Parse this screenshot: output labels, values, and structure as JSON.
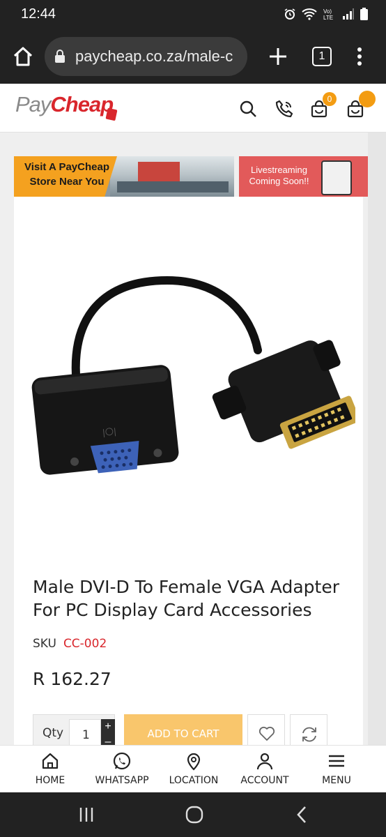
{
  "status_bar": {
    "time": "12:44",
    "icons": [
      "alarm-icon",
      "wifi-icon",
      "lte-icon",
      "signal-icon",
      "battery-icon"
    ]
  },
  "browser": {
    "url": "paycheap.co.za/male-c",
    "tab_count": "1"
  },
  "site": {
    "logo_pay": "Pay",
    "logo_cheap": "Cheap",
    "cart_count": "0"
  },
  "banners": {
    "store_text_line1": "Visit A PayCheap",
    "store_text_line2": "Store Near You",
    "live_text_line1": "Livestreaming",
    "live_text_line2": "Coming Soon!!"
  },
  "product": {
    "title": "Male DVI-D To Female VGA Adapter For PC Display Card Accessories",
    "sku_label": "SKU",
    "sku_value": "CC-002",
    "price": "R 162.27",
    "qty_label": "Qty",
    "qty_value": "1",
    "add_to_cart": "ADD TO CART"
  },
  "bottom_nav": [
    {
      "label": "HOME",
      "icon": "home-icon"
    },
    {
      "label": "WHATSAPP",
      "icon": "whatsapp-icon"
    },
    {
      "label": "LOCATION",
      "icon": "location-pin-icon"
    },
    {
      "label": "ACCOUNT",
      "icon": "user-icon"
    },
    {
      "label": "MENU",
      "icon": "hamburger-icon"
    }
  ],
  "colors": {
    "brand_red": "#d9262c",
    "accent_orange": "#f39c12",
    "add_to_cart_bg": "#f9c66c"
  }
}
